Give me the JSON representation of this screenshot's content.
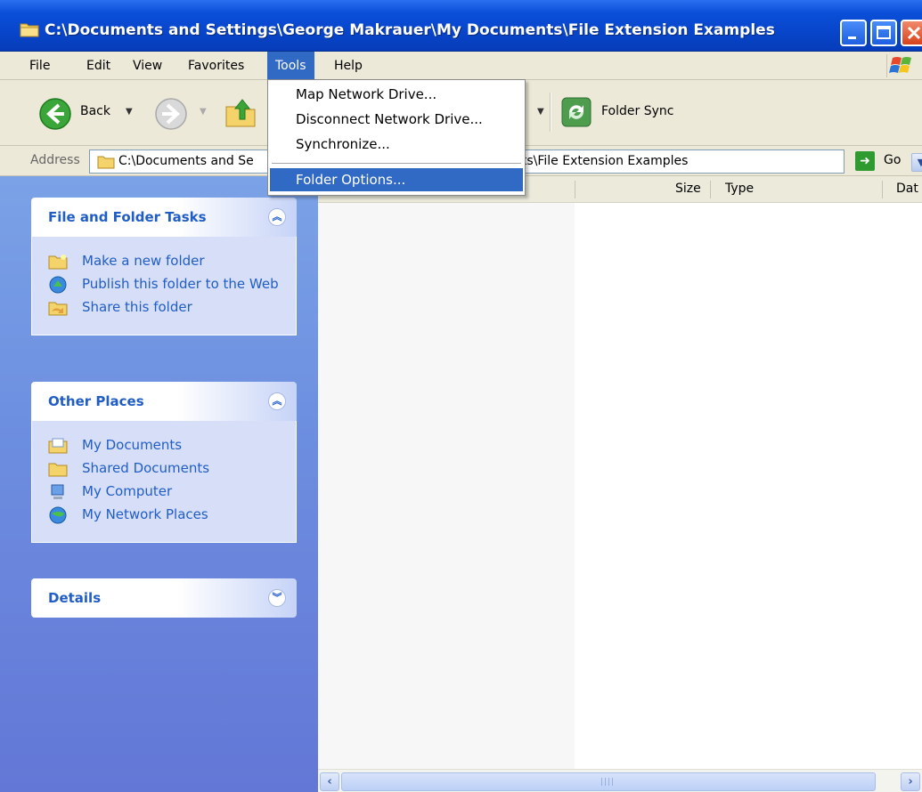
{
  "window": {
    "title": "C:\\Documents and Settings\\George Makrauer\\My Documents\\File Extension Examples"
  },
  "menubar": {
    "items": [
      "File",
      "Edit",
      "View",
      "Favorites",
      "Tools",
      "Help"
    ],
    "active": "Tools"
  },
  "tools_menu": {
    "items": [
      "Map Network Drive...",
      "Disconnect Network Drive...",
      "Synchronize...",
      "Folder Options..."
    ],
    "highlighted": "Folder Options..."
  },
  "toolbar": {
    "back_label": "Back",
    "sync_label": "Folder Sync"
  },
  "address": {
    "label": "Address",
    "visible_left": "C:\\Documents and Se",
    "visible_right": "nts\\File Extension Examples",
    "go_label": "Go"
  },
  "columns": [
    "Size",
    "Type",
    "Dat"
  ],
  "task_pane": {
    "panels": [
      {
        "title": "File and Folder Tasks",
        "toggle": "collapse",
        "items": [
          {
            "label": "Make a new folder",
            "icon": "new-folder-icon"
          },
          {
            "label": "Publish this folder to the Web",
            "icon": "publish-web-icon"
          },
          {
            "label": "Share this folder",
            "icon": "share-folder-icon"
          }
        ]
      },
      {
        "title": "Other Places",
        "toggle": "collapse",
        "items": [
          {
            "label": "My Documents",
            "icon": "my-documents-icon"
          },
          {
            "label": "Shared Documents",
            "icon": "shared-documents-icon"
          },
          {
            "label": "My Computer",
            "icon": "my-computer-icon"
          },
          {
            "label": "My Network Places",
            "icon": "network-places-icon"
          }
        ]
      },
      {
        "title": "Details",
        "toggle": "expand",
        "items": []
      }
    ]
  },
  "colors": {
    "titlebar": "#0a4fd8",
    "menu_highlight": "#316ac5",
    "task_link": "#215dc6",
    "pane_bg": "#6d8fe0"
  }
}
